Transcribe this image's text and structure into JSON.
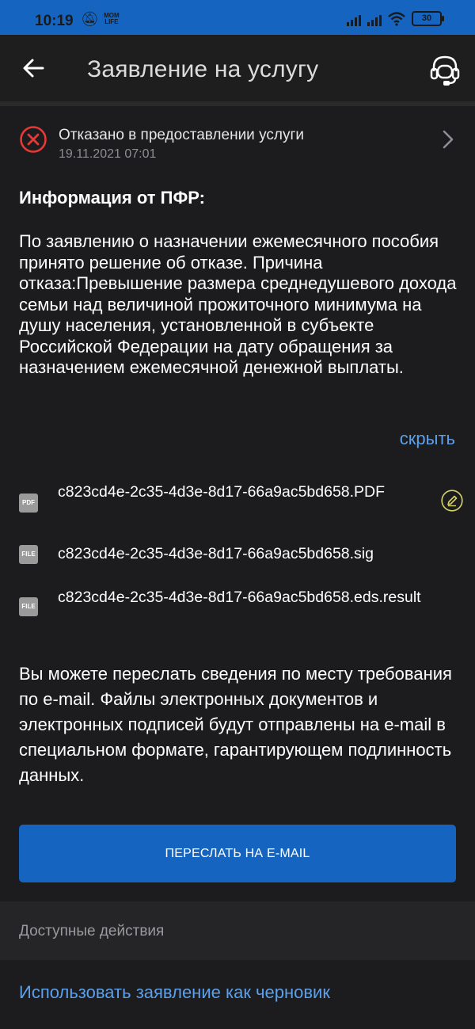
{
  "status_bar": {
    "time": "10:19",
    "carrier_badge": "MOM LIFE",
    "battery": "30"
  },
  "header": {
    "title": "Заявление на услугу",
    "back_icon": "arrow-left-icon",
    "support_icon": "headset-icon"
  },
  "application_status": {
    "title": "Отказано в предоставлении услуги",
    "date": "19.11.2021 07:01",
    "icon": "x-circle-icon",
    "status_color": "#e53935"
  },
  "info": {
    "heading": "Информация от ПФР:",
    "text": "По заявлению о назначении ежемесячного пособия принято решение об отказе. Причина отказа:Превышение размера среднедушевого дохода семьи над величиной прожиточного минимума на душу населения, установленной в субъекте Российской Федерации на дату обращения за назначением ежемесячной денежной выплаты.",
    "hide_label": "скрыть"
  },
  "files": [
    {
      "type_label": "PDF",
      "name": "c823cd4e-2c35-4d3e-8d17-66a9ac5bd658.PDF"
    },
    {
      "type_label": "FILE",
      "name": "c823cd4e-2c35-4d3e-8d17-66a9ac5bd658.sig"
    },
    {
      "type_label": "FILE",
      "name": "c823cd4e-2c35-4d3e-8d17-66a9ac5bd658.eds.result"
    }
  ],
  "forward": {
    "note": "Вы можете переслать сведения по месту требования по e-mail. Файлы электронных документов и электронных подписей будут отправлены на e-mail в специальном формате, гарантирующем подлинность данных.",
    "button_label": "ПЕРЕСЛАТЬ НА E-MAIL"
  },
  "actions": {
    "title": "Доступные действия",
    "draft_link": "Использовать заявление как черновик"
  },
  "colors": {
    "accent": "#1565c0",
    "link": "#5aa0ec",
    "background": "#1c1c1e",
    "sign_icon": "#d4d26a"
  }
}
